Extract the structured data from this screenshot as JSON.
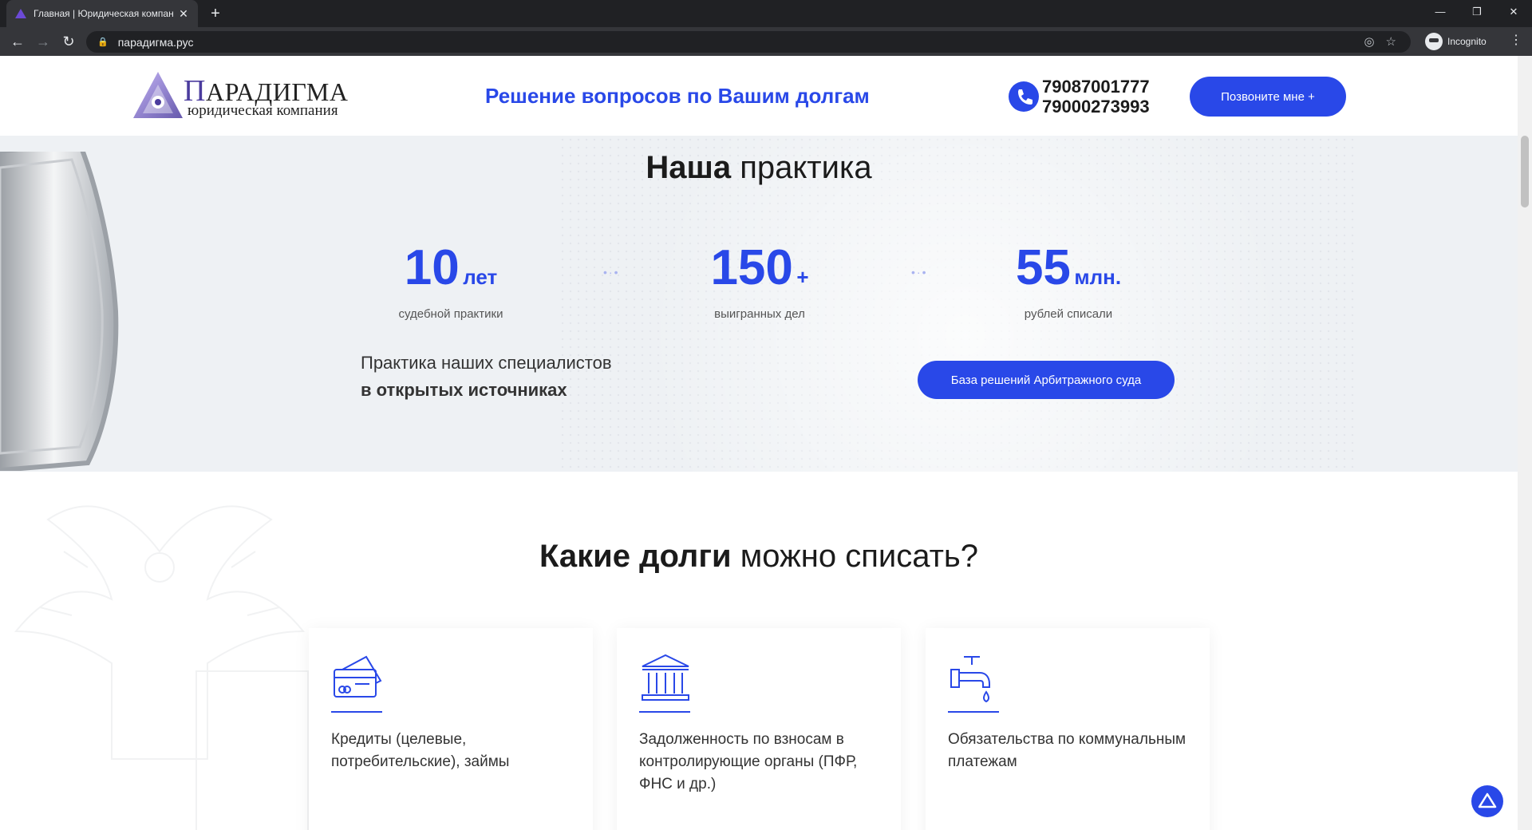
{
  "browser": {
    "tab_title": "Главная | Юридическая компан",
    "new_tab": "+",
    "url": "парадигма.рус",
    "profile": "Incognito"
  },
  "header": {
    "logo_name_first": "П",
    "logo_name_rest": "АРАДИГМА",
    "logo_sub": "юридическая компания",
    "slogan": "Решение вопросов по Вашим долгам",
    "phone_1": "79087001777",
    "phone_2": "79000273993",
    "call_button": "Позвоните мне +"
  },
  "practice": {
    "title_bold": "Наша",
    "title_rest": " практика",
    "stats": [
      {
        "num": "10",
        "unit": "лет",
        "caption": "судебной практики"
      },
      {
        "num": "150",
        "unit": "+",
        "caption": "выигранных дел"
      },
      {
        "num": "55",
        "unit": "млн.",
        "caption": "рублей списали"
      }
    ],
    "text_line1": "Практика наших специалистов",
    "text_line2": "в открытых источниках",
    "arb_button": "База решений Арбитражного суда"
  },
  "debts": {
    "title_bold": "Какие долги",
    "title_rest": " можно списать?",
    "cards": [
      {
        "icon": "credit-card-icon",
        "text": "Кредиты (целевые, потребительские), займы"
      },
      {
        "icon": "bank-building-icon",
        "text": "Задолженность по взносам в контролирующие органы (ПФР, ФНС и др.)"
      },
      {
        "icon": "water-tap-icon",
        "text": "Обязательства по коммунальным платежам"
      }
    ]
  },
  "colors": {
    "accent": "#2948e8",
    "chrome_dark": "#202124",
    "chrome_bar": "#35363a",
    "practice_bg": "#eef1f4"
  }
}
